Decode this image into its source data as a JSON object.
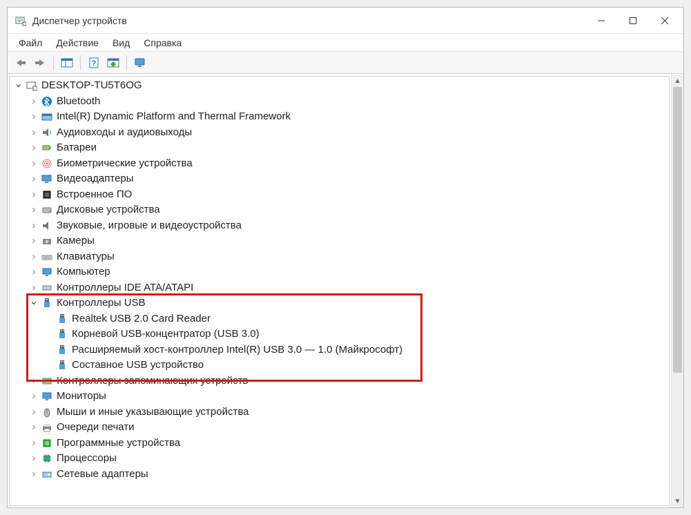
{
  "window": {
    "title": "Диспетчер устройств"
  },
  "menu": {
    "file": "Файл",
    "action": "Действие",
    "view": "Вид",
    "help": "Справка"
  },
  "tree": {
    "root": "DESKTOP-TU5T6OG",
    "bluetooth": "Bluetooth",
    "dptf": "Intel(R) Dynamic Platform and Thermal Framework",
    "audio": "Аудиовходы и аудиовыходы",
    "batteries": "Батареи",
    "biometric": "Биометрические устройства",
    "display": "Видеоадаптеры",
    "firmware": "Встроенное ПО",
    "disks": "Дисковые устройства",
    "soundgame": "Звуковые, игровые и видеоустройства",
    "cameras": "Камеры",
    "keyboards": "Клавиатуры",
    "computer": "Компьютер",
    "ide": "Контроллеры IDE ATA/ATAPI",
    "usbctrl": "Контроллеры USB",
    "usb_children": {
      "realtek": "Realtek USB 2.0 Card Reader",
      "roothub": "Корневой USB-концентратор (USB 3.0)",
      "xhci": "Расширяемый хост-контроллер Intel(R) USB 3.0 — 1.0 (Майкрософт)",
      "composite": "Составное USB устройство"
    },
    "storagectrl": "Контроллеры запоминающих устройств",
    "monitors": "Мониторы",
    "mice": "Мыши и иные указывающие устройства",
    "printq": "Очереди печати",
    "software": "Программные устройства",
    "cpus": "Процессоры",
    "netadapters": "Сетевые адаптеры"
  }
}
